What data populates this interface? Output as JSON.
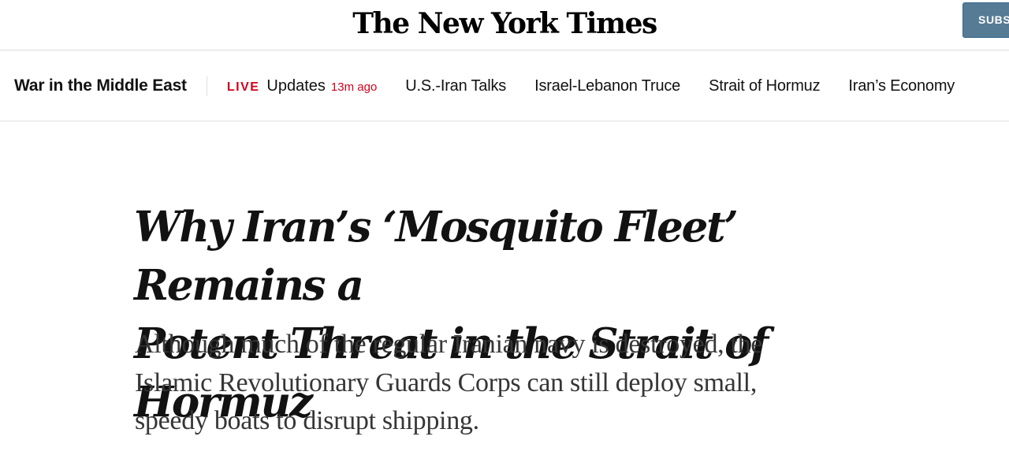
{
  "masthead": {
    "logo_text": "The New York Times",
    "subscribe_label": "SUBSCRIBE"
  },
  "section_nav": {
    "section_title": "War in the Middle East",
    "live": {
      "label": "LIVE",
      "text": "Updates",
      "timestamp": "13m ago"
    },
    "links": [
      "U.S.-Iran Talks",
      "Israel-Lebanon Truce",
      "Strait of Hormuz",
      "Iran’s Economy"
    ]
  },
  "article": {
    "headline_line1": "Why Iran’s ‘Mosquito Fleet’ Remains a",
    "headline_line2": "Potent Threat in the Strait of Hormuz",
    "summary_line1": "Although much of the regular Iranian navy is destroyed, the",
    "summary_line2": "Islamic Revolutionary Guards Corps can still deploy small,",
    "summary_line3": "speedy boats to disrupt shipping."
  },
  "colors": {
    "live_red": "#d0021b",
    "subscribe_blue": "#567b95",
    "text": "#121212",
    "summary_text": "#363636",
    "rule": "#dfdfdf"
  }
}
